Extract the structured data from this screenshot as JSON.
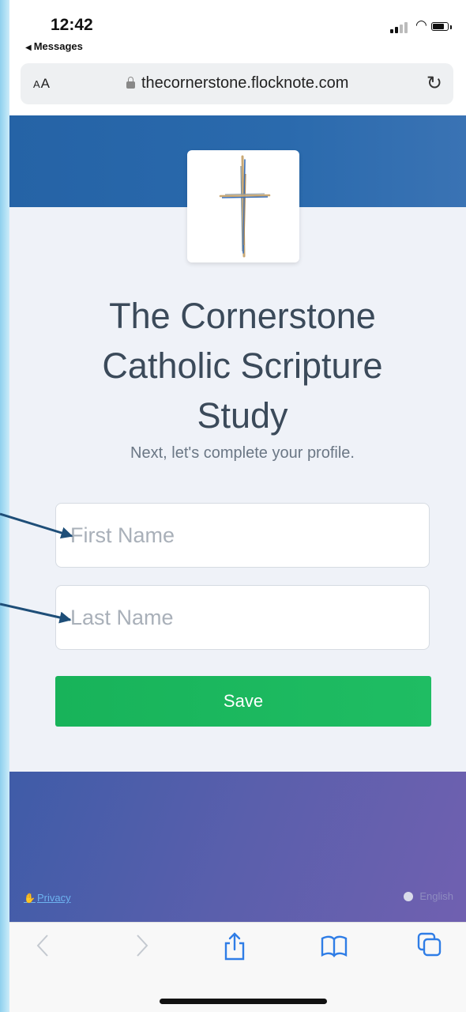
{
  "status_bar": {
    "time": "12:42",
    "back_app": "Messages",
    "signal_icon": "cellular-signal-icon",
    "wifi_icon": "wifi-icon",
    "battery_icon": "battery-icon"
  },
  "address_bar": {
    "text_size": "AA",
    "url": "thecornerstone.flocknote.com",
    "lock_icon": "lock-icon",
    "reload_icon": "reload-icon"
  },
  "page": {
    "logo": "cross-logo",
    "title": "The Cornerstone Catholic Scripture Study",
    "subtitle": "Next, let's complete your profile.",
    "first_name": {
      "value": "",
      "placeholder": "First Name"
    },
    "last_name": {
      "value": "",
      "placeholder": "Last Name"
    },
    "save_label": "Save",
    "privacy_link": "Privacy",
    "language": "English"
  },
  "toolbar": {
    "back_icon": "chevron-left-icon",
    "forward_icon": "chevron-right-icon",
    "share_icon": "share-icon",
    "bookmarks_icon": "book-icon",
    "tabs_icon": "tabs-icon"
  },
  "colors": {
    "header_blue": "#2563a6",
    "save_green": "#1cb85e",
    "footer_purple": "#5a5fac",
    "safari_blue": "#2f7de6",
    "arrow_navy": "#1e4e78"
  }
}
